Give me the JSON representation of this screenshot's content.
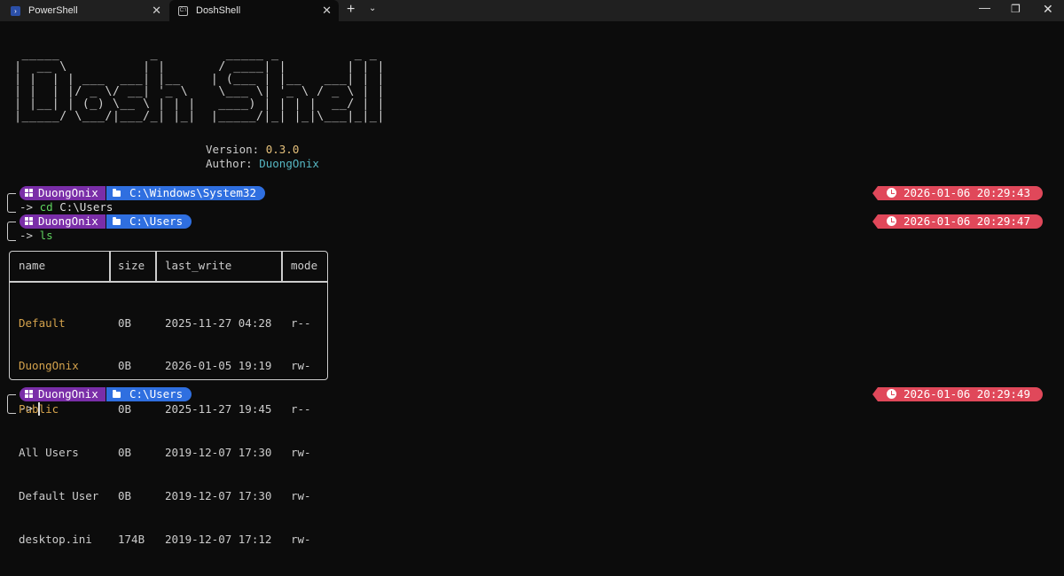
{
  "tabs": [
    {
      "label": "PowerShell",
      "icon": "powershell-icon"
    },
    {
      "label": "DoshShell",
      "icon": "terminal-icon",
      "active": true
    }
  ],
  "tabbar": {
    "new_tab": "+",
    "dropdown": "⌄",
    "close": "✕",
    "minimize": "—",
    "maximize": "❐",
    "window_close": "✕"
  },
  "banner": {
    "ascii": [
      " _____            _         _____ _          _ _ ",
      "|  __ \\          | |       / ____| |        | | |",
      "| |  | | ___  ___| |__    | (___ | |__   ___| | |",
      "| |  | |/ _ \\/ __| '_ \\    \\___ \\| '_ \\ / _ \\ | |",
      "| |__| | (_) \\__ \\ | | |   ____) | | | |  __/ | |",
      "|_____/ \\___/|___/_| |_|  |_____/|_| |_|\\___|_|_|"
    ],
    "version_label": "Version: ",
    "version": "0.3.0",
    "author_label": "Author: ",
    "author": "DuongOnix"
  },
  "prompts": [
    {
      "user": "DuongOnix",
      "path": "C:\\Windows\\System32",
      "command": "cd",
      "arg": "C:\\Users",
      "time": "2026-01-06 20:29:43"
    },
    {
      "user": "DuongOnix",
      "path": "C:\\Users",
      "command": "ls",
      "arg": "",
      "time": "2026-01-06 20:29:47"
    },
    {
      "user": "DuongOnix",
      "path": "C:\\Users",
      "command": "",
      "arg": "",
      "time": "2026-01-06 20:29:49"
    }
  ],
  "prompt_arrow": "->",
  "table": {
    "headers": [
      "name",
      "size",
      "last_write",
      "mode"
    ],
    "rows": [
      {
        "name": "Default",
        "size": "0B",
        "last_write": "2025-11-27 04:28",
        "mode": "r--",
        "type": "dir"
      },
      {
        "name": "DuongOnix",
        "size": "0B",
        "last_write": "2026-01-05 19:19",
        "mode": "rw-",
        "type": "dir"
      },
      {
        "name": "Public",
        "size": "0B",
        "last_write": "2025-11-27 19:45",
        "mode": "r--",
        "type": "dir"
      },
      {
        "name": "All Users",
        "size": "0B",
        "last_write": "2019-12-07 17:30",
        "mode": "rw-",
        "type": "file"
      },
      {
        "name": "Default User",
        "size": "0B",
        "last_write": "2019-12-07 17:30",
        "mode": "rw-",
        "type": "file"
      },
      {
        "name": "desktop.ini",
        "size": "174B",
        "last_write": "2019-12-07 17:12",
        "mode": "rw-",
        "type": "file"
      }
    ]
  },
  "colors": {
    "background": "#0c0c0c",
    "user_segment": "#7a2ea8",
    "path_segment": "#2f6fe0",
    "clock_segment": "#e0485a",
    "directory": "#d4a24c",
    "command": "#5fd35f"
  }
}
